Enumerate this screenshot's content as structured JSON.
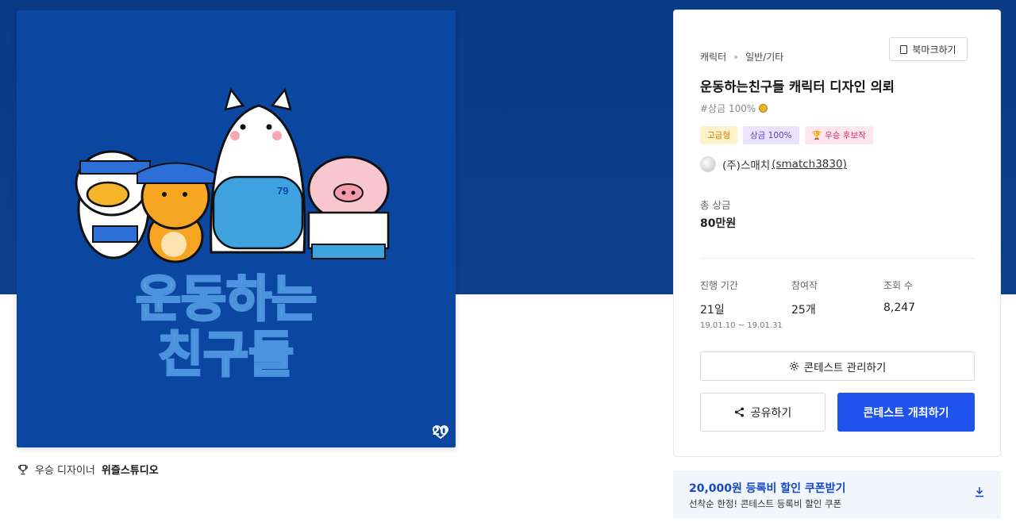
{
  "artwork": {
    "text_line1": "운동하는",
    "text_line2": "친구들",
    "jersey_number": "79",
    "like_count": "20"
  },
  "winner": {
    "label": "우승 디자이너",
    "name": "위즐스튜디오"
  },
  "contest": {
    "category": "캐릭터",
    "subcategory": "일반/기타",
    "bookmark_label": "북마크하기",
    "title": "운동하는친구들 캐릭터 디자인 의뢰",
    "tagline": "#상금 100%",
    "badges": [
      "고급형",
      "상금 100%",
      "우승 후보작"
    ],
    "owner_name": "(주)스매치",
    "owner_id": "(smatch3830)",
    "prize_label": "총 상금",
    "prize_value": "80만원",
    "stats": {
      "period_label": "진행 기간",
      "period_value": "21일",
      "period_range": "19.01.10 ~ 19.01.31",
      "participants_label": "참여작",
      "participants_value": "25개",
      "views_label": "조회 수",
      "views_value": "8,247"
    },
    "manage_label": "콘테스트 관리하기",
    "share_label": "공유하기",
    "host_label": "콘테스트 개최하기"
  },
  "coupon": {
    "title": "20,000원 등록비 할인 쿠폰받기",
    "subtitle": "선착순 한정! 콘테스트 등록비 할인 쿠폰"
  },
  "colors": {
    "hero_bg": "#0a3b86",
    "artwork_bg": "#0b47a0",
    "primary": "#1f53ec",
    "coupon_text": "#1746c5"
  }
}
